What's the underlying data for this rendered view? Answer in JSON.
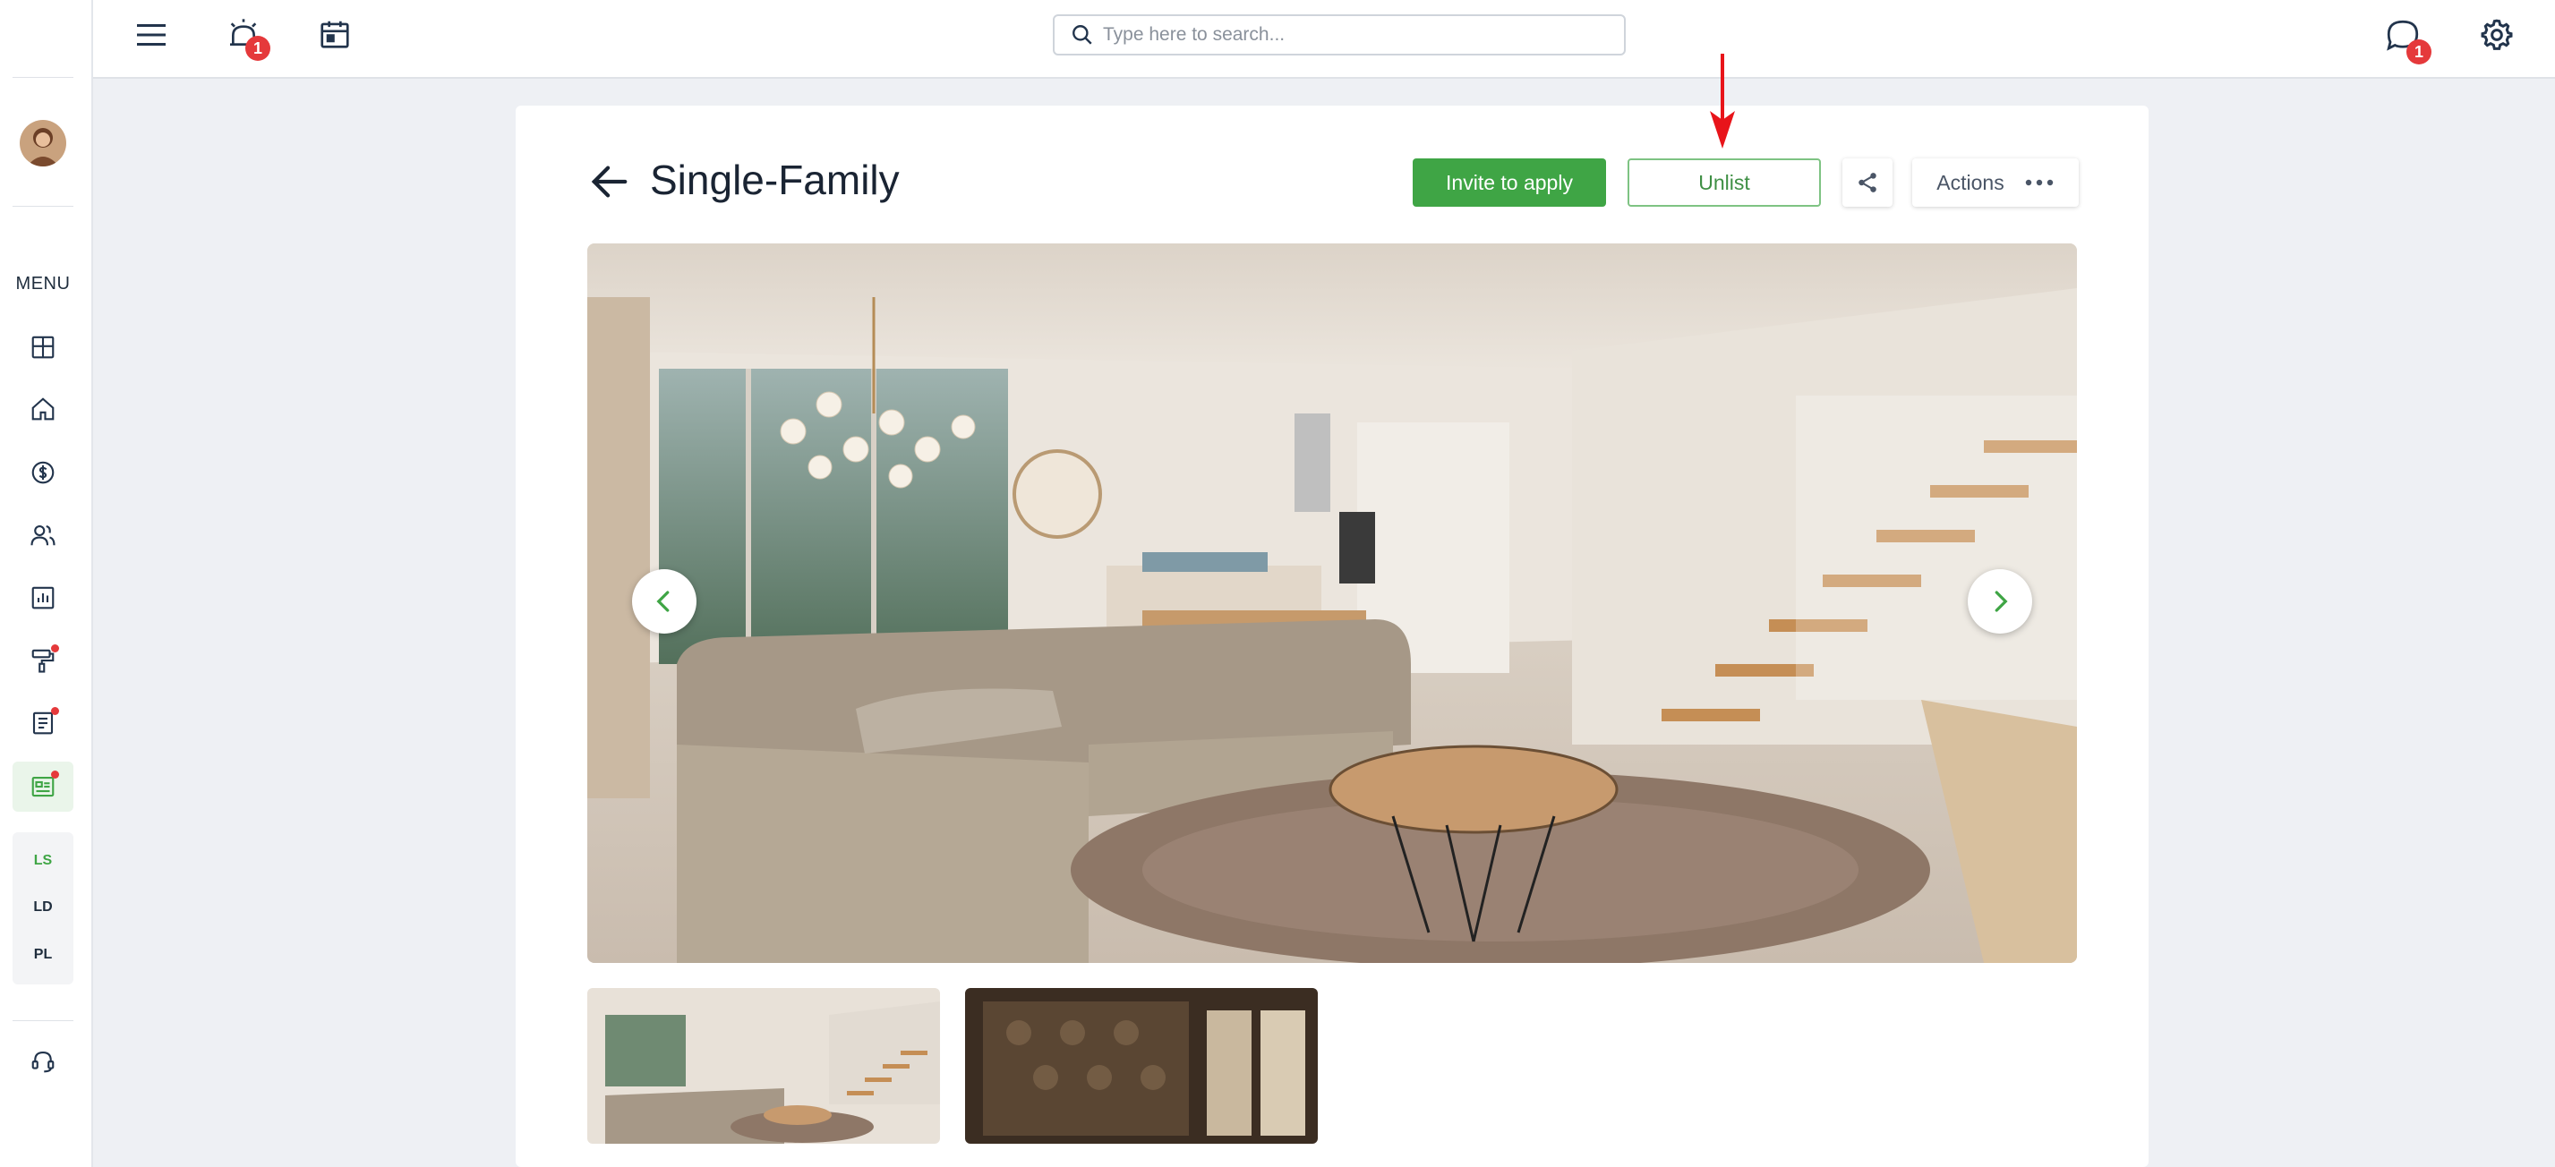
{
  "sidebar": {
    "menu_label": "MENU",
    "items": [
      {
        "name": "dashboard-icon",
        "dot": false
      },
      {
        "name": "home-icon",
        "dot": false
      },
      {
        "name": "dollar-icon",
        "dot": false
      },
      {
        "name": "people-icon",
        "dot": false
      },
      {
        "name": "report-icon",
        "dot": false
      },
      {
        "name": "paint-roller-icon",
        "dot": true
      },
      {
        "name": "document-icon",
        "dot": true
      },
      {
        "name": "listing-icon",
        "dot": true,
        "active": true
      }
    ],
    "sub_items": [
      {
        "label": "LS",
        "active": true
      },
      {
        "label": "LD",
        "active": false
      },
      {
        "label": "PL",
        "active": false
      }
    ],
    "support_icon": "headset-icon"
  },
  "topbar": {
    "alarm_badge": "1",
    "chat_badge": "1",
    "search_placeholder": "Type here to search..."
  },
  "page": {
    "title": "Single-Family",
    "buttons": {
      "invite": "Invite to apply",
      "unlist": "Unlist",
      "actions": "Actions"
    }
  },
  "colors": {
    "primary_green": "#3fa545",
    "badge_red": "#e5393b",
    "annotation_arrow": "#e8141a"
  }
}
